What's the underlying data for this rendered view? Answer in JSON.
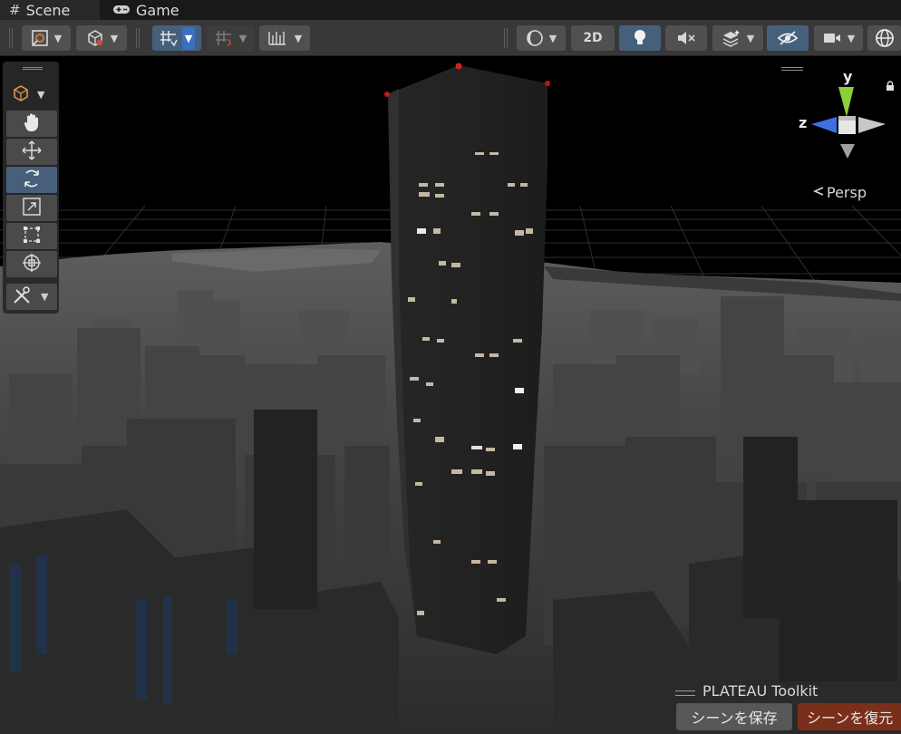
{
  "tabs": [
    {
      "label": "Scene",
      "icon": "hash-icon"
    },
    {
      "label": "Game",
      "icon": "gamepad-icon"
    }
  ],
  "toolbar": {
    "toggle_2d_label": "2D",
    "lighting_on": true,
    "grid_snapping_on": true,
    "hidden_objects_toggle_on": true
  },
  "tools": {
    "active_tool": "rotate",
    "items": [
      "view-tool",
      "move-tool",
      "rotate-tool",
      "scale-tool",
      "rect-tool",
      "transform-tool",
      "custom-editor-tool"
    ]
  },
  "gizmo": {
    "y_label": "y",
    "z_label": "z",
    "projection_label": "Persp"
  },
  "plateau": {
    "title": "PLATEAU Toolkit",
    "save_label": "シーンを保存",
    "restore_label": "シーンを復元"
  },
  "colors": {
    "accent": "#46607c",
    "restore_button": "#7a2f1a",
    "gizmo_y": "#8ccf36",
    "gizmo_z": "#3d6fe0"
  }
}
